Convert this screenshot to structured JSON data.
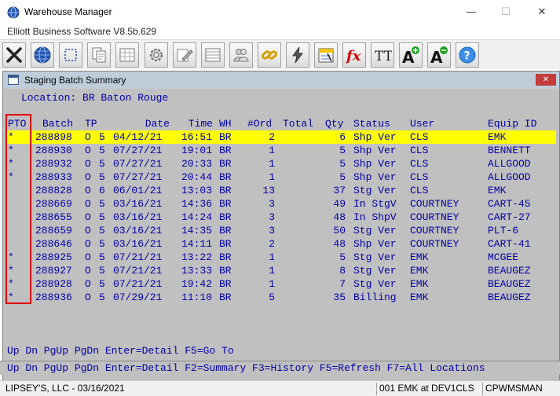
{
  "app": {
    "title": "Warehouse Manager",
    "subtitle": "Elliott Business Software V8.5b.629",
    "window_controls": {
      "minimize": "—",
      "maximize": "☐",
      "close": "✕"
    }
  },
  "toolbar": {
    "icons": [
      "close-x-icon",
      "globe-icon",
      "select-box-icon",
      "copy-pages-icon",
      "table-icon",
      "gear-icon",
      "edit-icon",
      "list-icon",
      "users-icon",
      "chain-link-icon",
      "lightning-icon",
      "calendar-icon",
      "function-icon",
      "font-tt-icon",
      "font-increase-icon",
      "font-decrease-icon",
      "help-icon"
    ],
    "labels": {
      "fx": "fx",
      "tt": "TT",
      "a_plus": "A",
      "a_minus": "A",
      "help": "?"
    }
  },
  "child_window": {
    "title": "Staging Batch Summary",
    "close": "✕"
  },
  "location_line": "Location: BR Baton Rouge",
  "table": {
    "headers": {
      "pto": "PTO",
      "batch": "Batch",
      "tp": "TP",
      "date": "Date",
      "time": "Time",
      "wh": "WH",
      "ord": "#Ord",
      "total": "Total",
      "qty": "Qty",
      "status": "Status",
      "user": "User",
      "equip": "Equip ID"
    },
    "rows": [
      {
        "pto": "*",
        "batch": "288898",
        "o": "O",
        "tp": "5",
        "date": "04/12/21",
        "time": "16:51",
        "wh": "BR",
        "ord": "2",
        "total": "",
        "qty": "6",
        "status": "Shp Ver",
        "user": "CLS",
        "equip": "EMK",
        "selected": true
      },
      {
        "pto": "*",
        "batch": "288930",
        "o": "O",
        "tp": "5",
        "date": "07/27/21",
        "time": "19:01",
        "wh": "BR",
        "ord": "1",
        "total": "",
        "qty": "5",
        "status": "Shp Ver",
        "user": "CLS",
        "equip": "BENNETT"
      },
      {
        "pto": "*",
        "batch": "288932",
        "o": "O",
        "tp": "5",
        "date": "07/27/21",
        "time": "20:33",
        "wh": "BR",
        "ord": "1",
        "total": "",
        "qty": "5",
        "status": "Shp Ver",
        "user": "CLS",
        "equip": "ALLGOOD"
      },
      {
        "pto": "*",
        "batch": "288933",
        "o": "O",
        "tp": "5",
        "date": "07/27/21",
        "time": "20:44",
        "wh": "BR",
        "ord": "1",
        "total": "",
        "qty": "5",
        "status": "Shp Ver",
        "user": "CLS",
        "equip": "ALLGOOD"
      },
      {
        "pto": "",
        "batch": "288828",
        "o": "O",
        "tp": "6",
        "date": "06/01/21",
        "time": "13:03",
        "wh": "BR",
        "ord": "13",
        "total": "",
        "qty": "37",
        "status": "Stg Ver",
        "user": "CLS",
        "equip": "EMK"
      },
      {
        "pto": "",
        "batch": "288669",
        "o": "O",
        "tp": "5",
        "date": "03/16/21",
        "time": "14:36",
        "wh": "BR",
        "ord": "3",
        "total": "",
        "qty": "49",
        "status": "In StgV",
        "user": "COURTNEY",
        "equip": "CART-45"
      },
      {
        "pto": "",
        "batch": "288655",
        "o": "O",
        "tp": "5",
        "date": "03/16/21",
        "time": "14:24",
        "wh": "BR",
        "ord": "3",
        "total": "",
        "qty": "48",
        "status": "In ShpV",
        "user": "COURTNEY",
        "equip": "CART-27"
      },
      {
        "pto": "",
        "batch": "288659",
        "o": "O",
        "tp": "5",
        "date": "03/16/21",
        "time": "14:35",
        "wh": "BR",
        "ord": "3",
        "total": "",
        "qty": "50",
        "status": "Stg Ver",
        "user": "COURTNEY",
        "equip": "PLT-6"
      },
      {
        "pto": "",
        "batch": "288646",
        "o": "O",
        "tp": "5",
        "date": "03/16/21",
        "time": "14:11",
        "wh": "BR",
        "ord": "2",
        "total": "",
        "qty": "48",
        "status": "Shp Ver",
        "user": "COURTNEY",
        "equip": "CART-41"
      },
      {
        "pto": "*",
        "batch": "288925",
        "o": "O",
        "tp": "5",
        "date": "07/21/21",
        "time": "13:22",
        "wh": "BR",
        "ord": "1",
        "total": "",
        "qty": "5",
        "status": "Stg Ver",
        "user": "EMK",
        "equip": "MCGEE"
      },
      {
        "pto": "*",
        "batch": "288927",
        "o": "O",
        "tp": "5",
        "date": "07/21/21",
        "time": "13:33",
        "wh": "BR",
        "ord": "1",
        "total": "",
        "qty": "8",
        "status": "Stg Ver",
        "user": "EMK",
        "equip": "BEAUGEZ"
      },
      {
        "pto": "*",
        "batch": "288928",
        "o": "O",
        "tp": "5",
        "date": "07/21/21",
        "time": "19:42",
        "wh": "BR",
        "ord": "1",
        "total": "",
        "qty": "7",
        "status": "Stg Ver",
        "user": "EMK",
        "equip": "BEAUGEZ"
      },
      {
        "pto": "*",
        "batch": "288936",
        "o": "O",
        "tp": "5",
        "date": "07/29/21",
        "time": "11:10",
        "wh": "BR",
        "ord": "5",
        "total": "",
        "qty": "35",
        "status": "Billing",
        "user": "EMK",
        "equip": "BEAUGEZ"
      }
    ]
  },
  "nav_line": "Up Dn PgUp PgDn Enter=Detail F5=Go To",
  "fkey_line": "Up Dn PgUp PgDn Enter=Detail F2=Summary F3=History F5=Refresh F7=All Locations",
  "status_bar": {
    "company": "LIPSEY'S, LLC - 03/16/2021",
    "session": "001 EMK at DEV1CLS",
    "module": "CPWMSMAN"
  },
  "colors": {
    "terminal_bg": "#c0c0c0",
    "terminal_text": "#0000a8",
    "selected_row": "#ffff00",
    "highlight_box": "#e00000"
  }
}
